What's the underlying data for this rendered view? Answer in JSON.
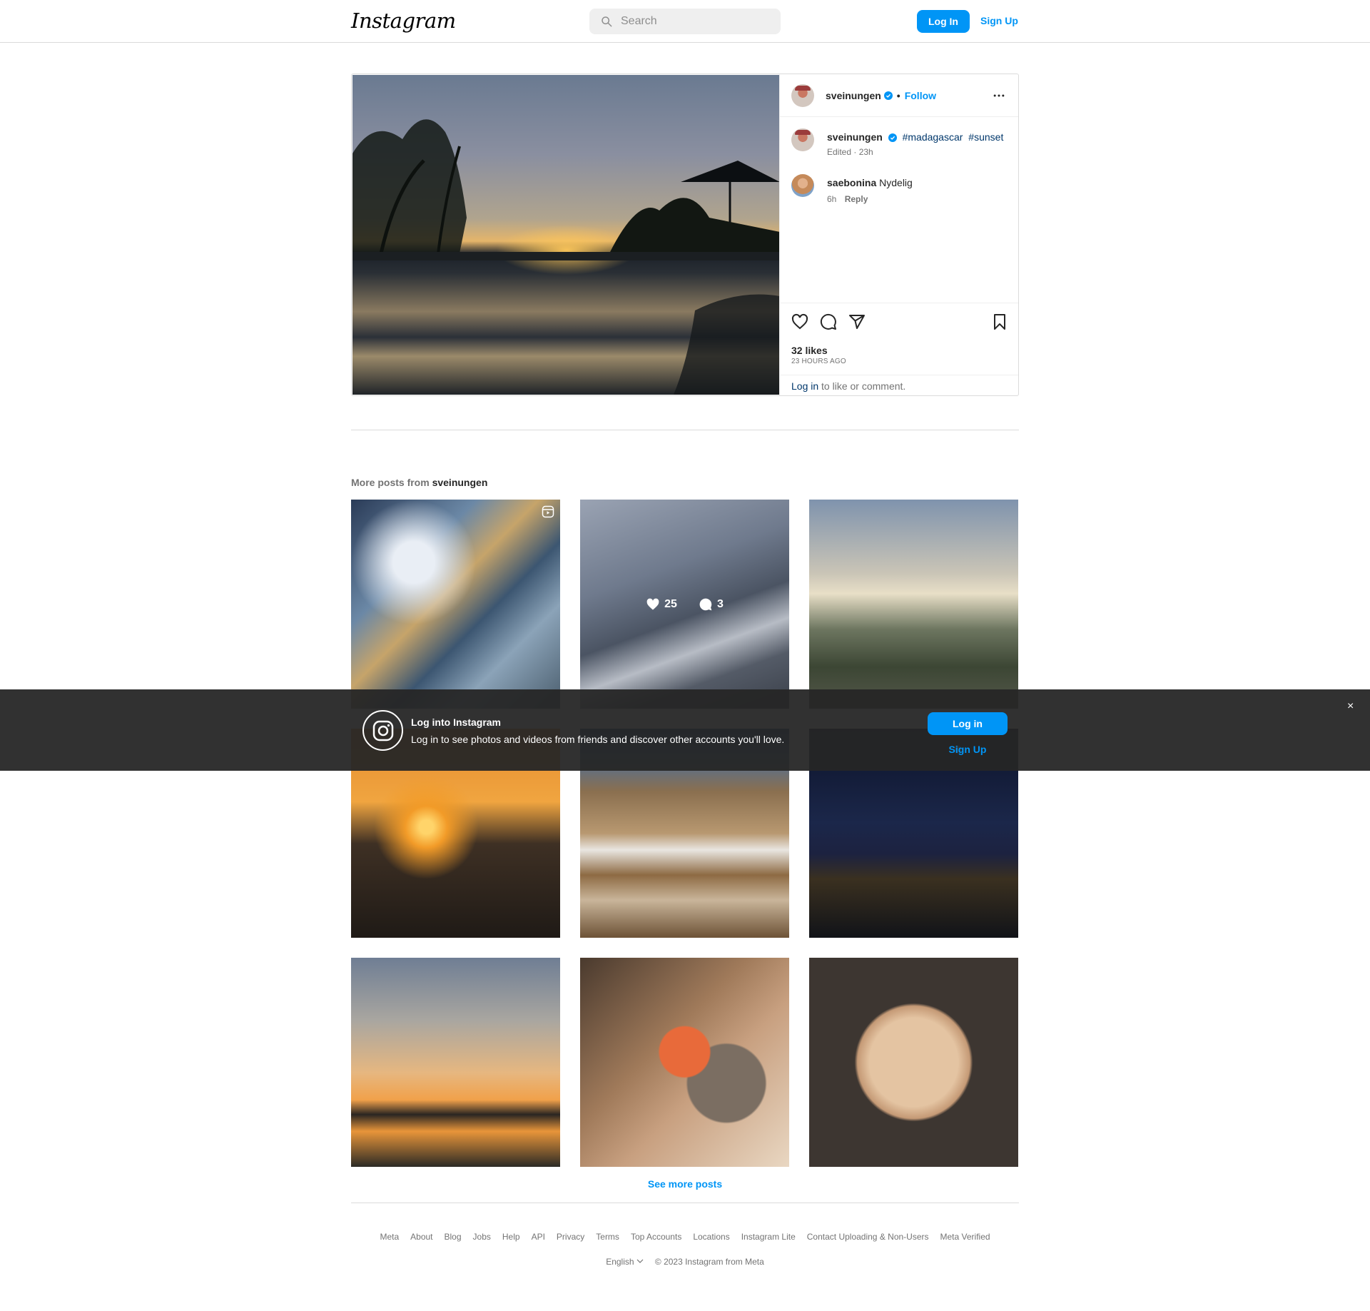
{
  "nav": {
    "logo": "Instagram",
    "search_placeholder": "Search",
    "login": "Log In",
    "signup": "Sign Up"
  },
  "post": {
    "username": "sveinungen",
    "follow": "Follow",
    "separator": "•",
    "caption_tags": [
      "#madagascar",
      "#sunset"
    ],
    "caption_meta": "Edited · 23h",
    "comment": {
      "username": "saebonina",
      "text": "Nydelig",
      "time": "6h",
      "reply": "Reply"
    },
    "likes": "32 likes",
    "time_ago": "23 HOURS AGO",
    "login_link": "Log in",
    "login_suffix": " to like or comment."
  },
  "more_posts": {
    "prefix": "More posts from ",
    "username": "sveinungen",
    "hover_stats": {
      "likes": "25",
      "comments": "3"
    },
    "see_more": "See more posts"
  },
  "banner": {
    "title": "Log into Instagram",
    "text": "Log in to see photos and videos from friends and discover other accounts you'll love.",
    "login": "Log in",
    "signup": "Sign Up",
    "close": "×"
  },
  "footer": {
    "links": [
      "Meta",
      "About",
      "Blog",
      "Jobs",
      "Help",
      "API",
      "Privacy",
      "Terms",
      "Top Accounts",
      "Locations",
      "Instagram Lite",
      "Contact Uploading & Non-Users",
      "Meta Verified"
    ],
    "language": "English",
    "copyright": "© 2023 Instagram from Meta"
  },
  "colors": {
    "accent": "#0095f6",
    "link_dark": "#00376b",
    "banner_bg": "#262626"
  }
}
